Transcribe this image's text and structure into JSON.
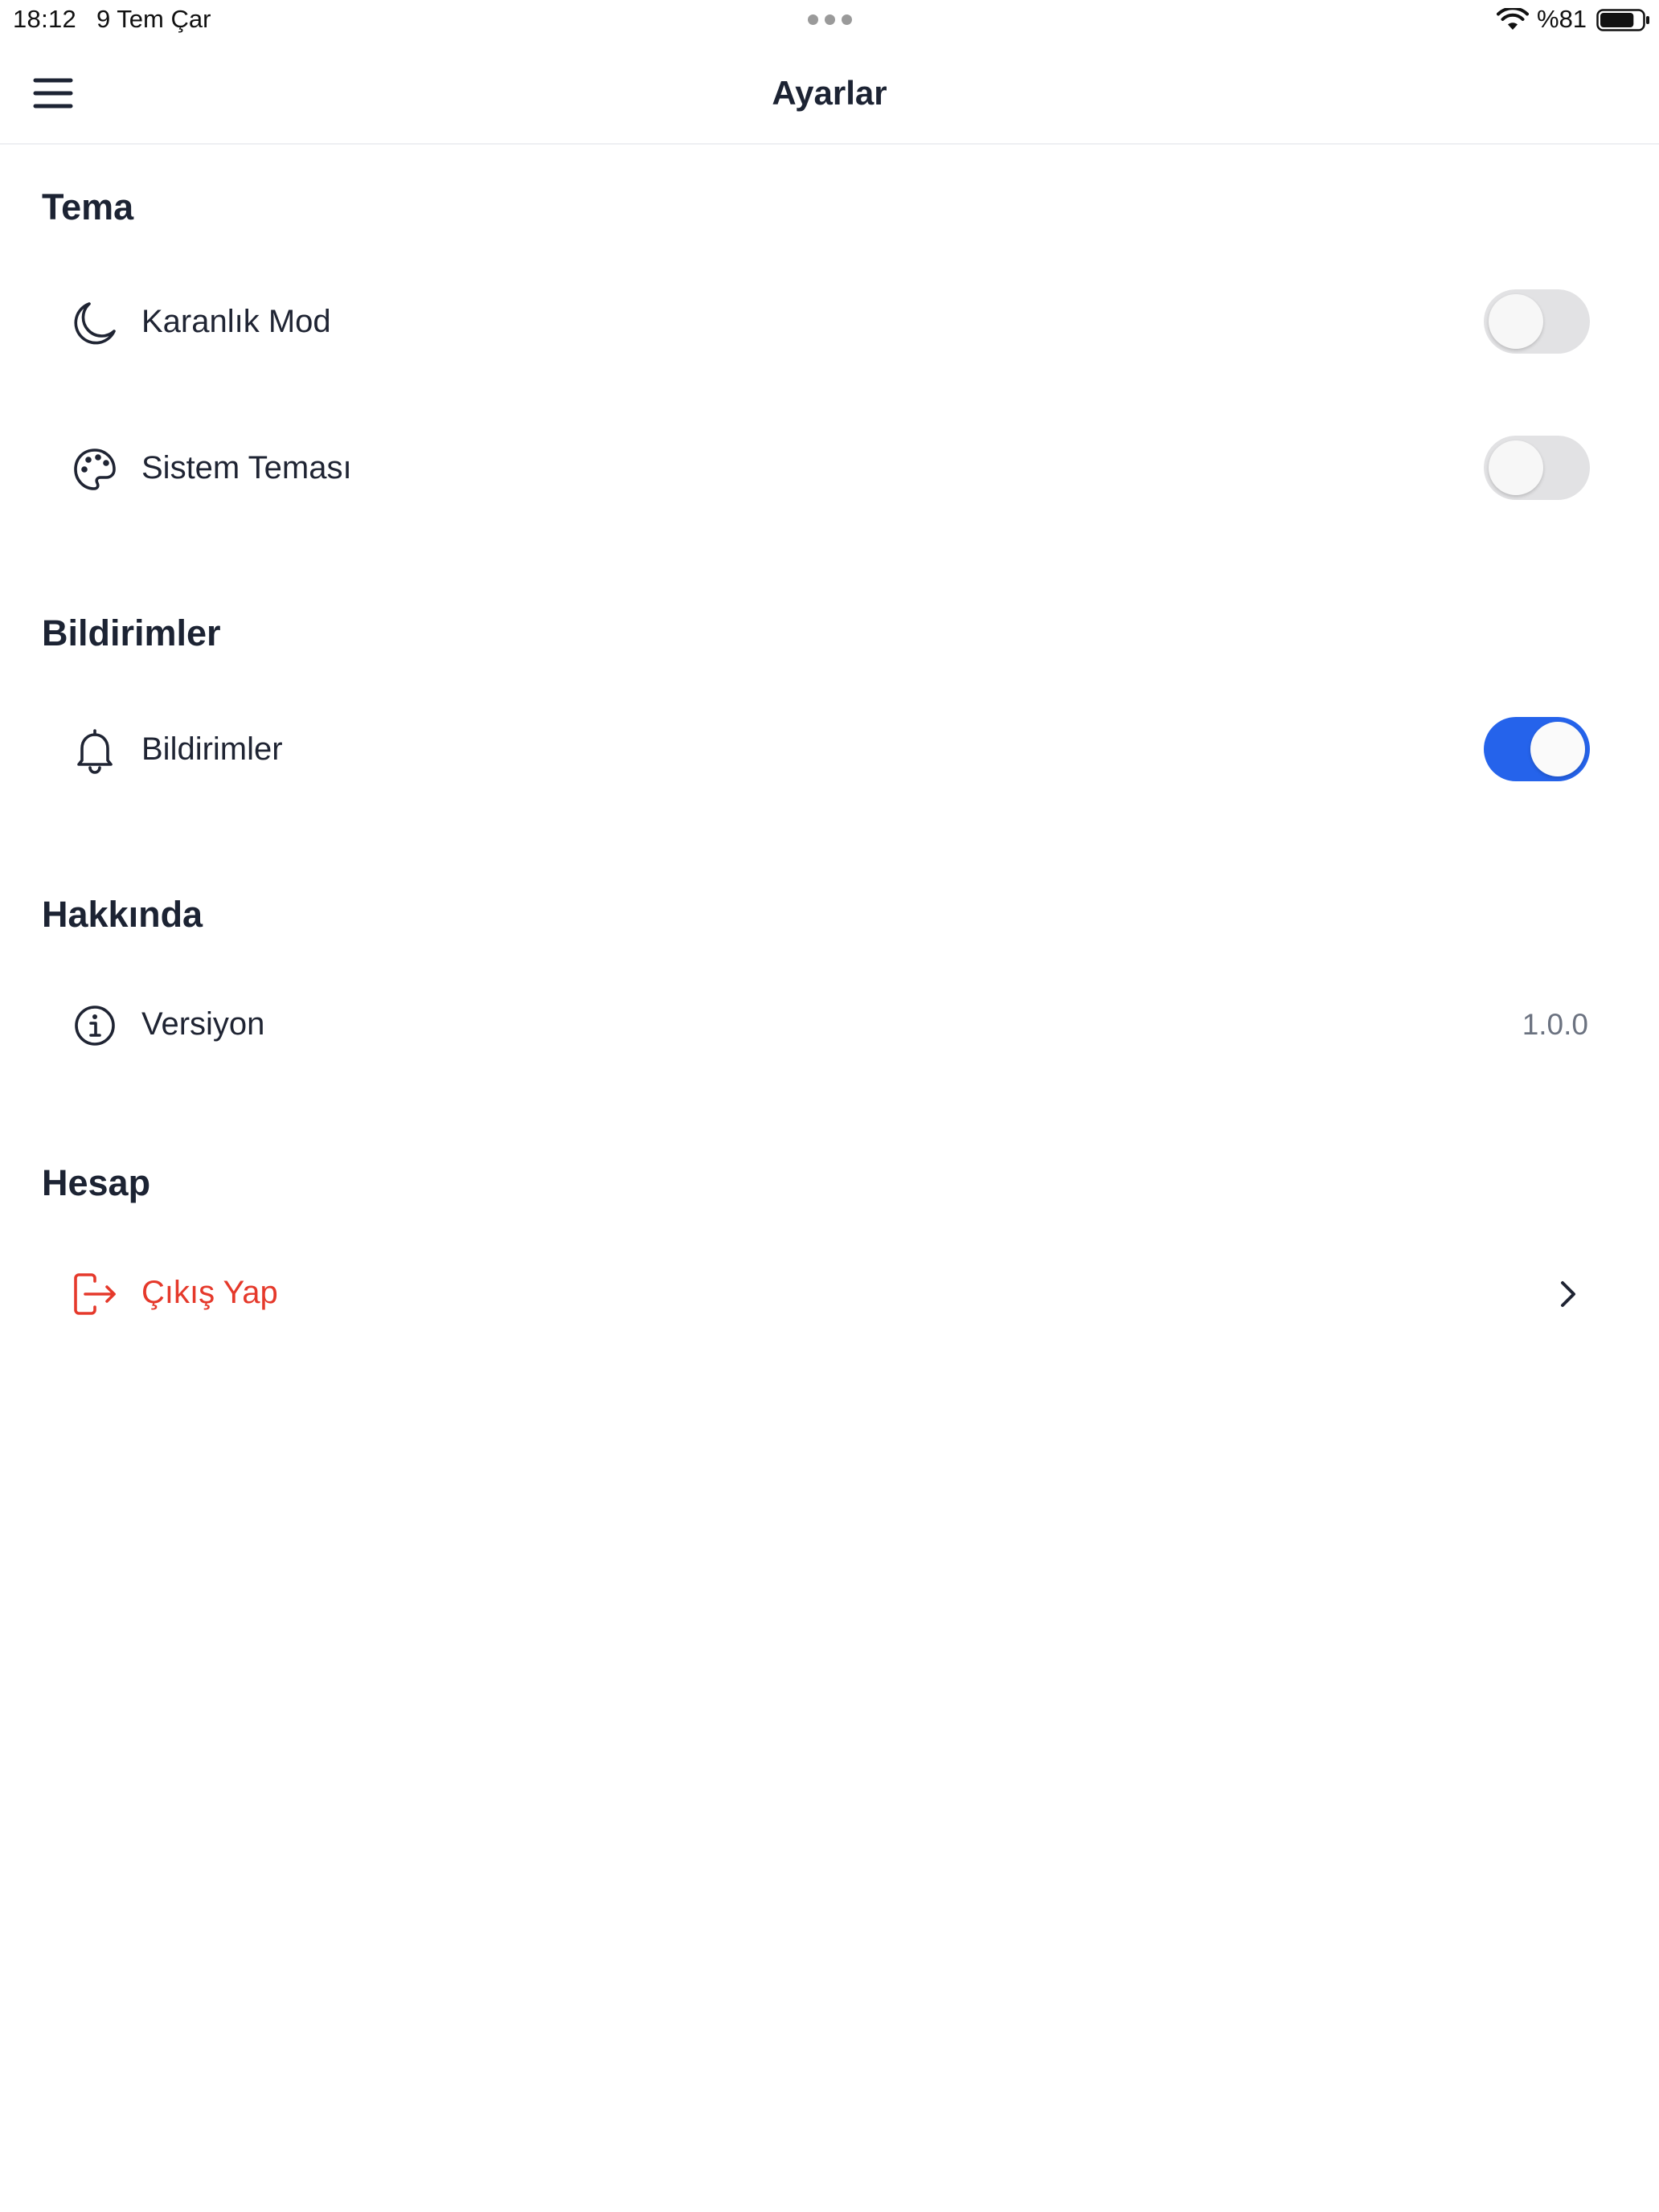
{
  "status_bar": {
    "time": "18:12",
    "date": "9 Tem Çar",
    "battery_percent": "%81",
    "battery_level": 0.81,
    "icons": [
      "wifi-icon",
      "battery-icon",
      "multitask-dots-icon"
    ]
  },
  "nav": {
    "title": "Ayarlar",
    "menu_icon": "hamburger-menu-icon"
  },
  "sections": {
    "theme": {
      "title": "Tema",
      "items": [
        {
          "label": "Karanlık Mod",
          "icon": "moon-icon",
          "toggle": false
        },
        {
          "label": "Sistem Teması",
          "icon": "palette-icon",
          "toggle": false
        }
      ]
    },
    "notifications": {
      "title": "Bildirimler",
      "items": [
        {
          "label": "Bildirimler",
          "icon": "bell-icon",
          "toggle": true
        }
      ]
    },
    "about": {
      "title": "Hakkında",
      "items": [
        {
          "label": "Versiyon",
          "icon": "info-icon",
          "value": "1.0.0"
        }
      ]
    },
    "account": {
      "title": "Hesap",
      "items": [
        {
          "label": "Çıkış Yap",
          "icon": "logout-icon",
          "trailing_icon": "chevron-right-icon"
        }
      ]
    }
  },
  "colors": {
    "text_primary": "#1c2333",
    "text_secondary": "#6b7280",
    "accent": "#2563eb",
    "toggle_off": "#e2e2e4",
    "danger": "#e5392b",
    "divider": "#eeeff2"
  }
}
